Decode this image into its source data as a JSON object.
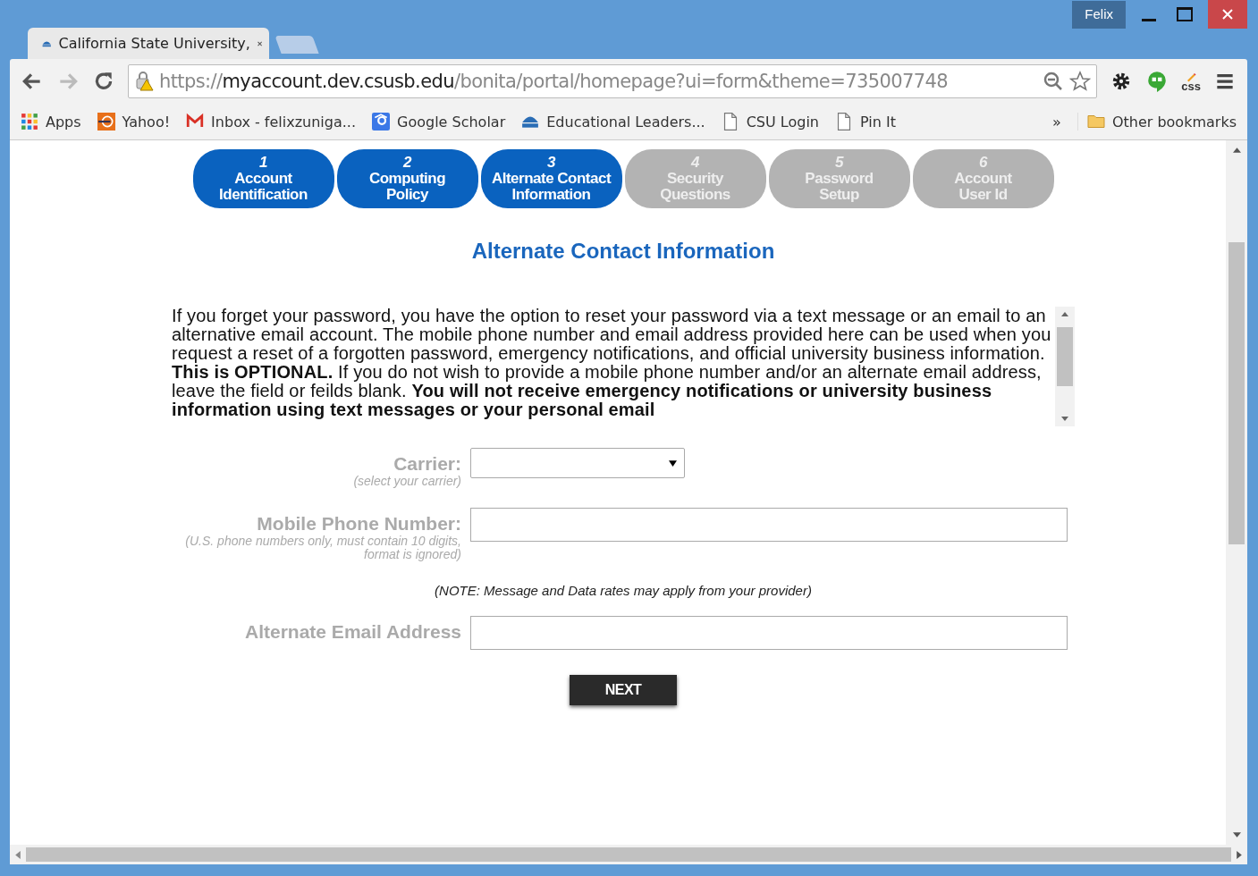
{
  "window": {
    "profile": "Felix"
  },
  "tabs": [
    {
      "title": "California State University,",
      "selected": true
    }
  ],
  "address_bar": {
    "scheme": "https://",
    "host": "myaccount.dev.csusb.edu",
    "path": "/bonita/portal/homepage?ui=form&theme=735007748"
  },
  "bookmarks": [
    {
      "label": "Apps",
      "kind": "apps"
    },
    {
      "label": "Yahoo!",
      "kind": "yahoo"
    },
    {
      "label": "Inbox - felixzuniga...",
      "kind": "mail"
    },
    {
      "label": "Google Scholar",
      "kind": "scholar"
    },
    {
      "label": "Educational Leaders...",
      "kind": "csusb"
    },
    {
      "label": "CSU Login",
      "kind": "page"
    },
    {
      "label": "Pin It",
      "kind": "page"
    }
  ],
  "bookmarks_overflow": "»",
  "other_bookmarks": "Other bookmarks",
  "extensions": [
    {
      "kind": "gear"
    },
    {
      "kind": "hangouts"
    },
    {
      "kind": "css",
      "label": "css"
    }
  ],
  "steps": [
    {
      "number": "1",
      "lines": [
        "Account",
        "Identification"
      ],
      "active": true
    },
    {
      "number": "2",
      "lines": [
        "Computing",
        "Policy"
      ],
      "active": true
    },
    {
      "number": "3",
      "lines": [
        "Alternate Contact",
        "Information"
      ],
      "active": true
    },
    {
      "number": "4",
      "lines": [
        "Security",
        "Questions"
      ],
      "active": false
    },
    {
      "number": "5",
      "lines": [
        "Password",
        "Setup"
      ],
      "active": false
    },
    {
      "number": "6",
      "lines": [
        "Account",
        "User Id"
      ],
      "active": false
    }
  ],
  "heading": "Alternate Contact Information",
  "notice": "If you forget your password, you have the option to reset your password via a text message or an email to an alternative email account. The mobile phone number and email address provided here can be used when you request a reset of a forgotten password, emergency notifications, and official university business information. **This is OPTIONAL.** If you do not wish to provide a mobile phone number and/or an alternate email address, leave the field or feilds blank. **You will not receive emergency notifications or university business information using text messages or your personal email**",
  "fields": [
    {
      "label": "Carrier:",
      "hint": "(select your carrier)",
      "kind": "select"
    },
    {
      "label": "Mobile Phone Number:",
      "hint": "(U.S. phone numbers only, must contain 10 digits, format is ignored)",
      "kind": "text"
    },
    {
      "note": "(NOTE: Message and Data rates may apply from your provider)",
      "kind": "note"
    },
    {
      "label": "Alternate Email Address",
      "kind": "text"
    }
  ],
  "next_button": "NEXT"
}
